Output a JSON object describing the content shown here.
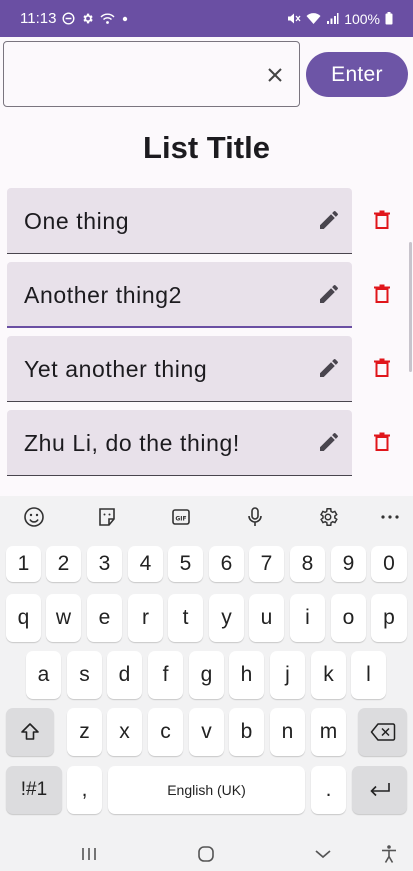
{
  "status_bar": {
    "time": "11:13",
    "battery": "100%",
    "left_icons": [
      "do-not-disturb-icon",
      "gear-icon",
      "wifi-calling-icon",
      "dot-icon"
    ],
    "right_icons": [
      "mute-icon",
      "wifi-icon",
      "signal-icon",
      "battery-icon"
    ]
  },
  "input": {
    "value": "",
    "placeholder": "",
    "clear_icon": "close-icon",
    "enter_label": "Enter"
  },
  "list": {
    "title": "List Title",
    "items": [
      {
        "text": "One thing",
        "edit_icon": "pencil-icon",
        "delete_icon": "trash-icon"
      },
      {
        "text": "Another thing2",
        "edit_icon": "pencil-icon",
        "delete_icon": "trash-icon",
        "focused": true
      },
      {
        "text": "Yet another thing",
        "edit_icon": "pencil-icon",
        "delete_icon": "trash-icon"
      },
      {
        "text": "Zhu Li, do the thing!",
        "edit_icon": "pencil-icon",
        "delete_icon": "trash-icon"
      }
    ]
  },
  "keyboard": {
    "toolbar": [
      "emoji-icon",
      "sticker-icon",
      "gif-icon",
      "microphone-icon",
      "settings-icon",
      "more-icon"
    ],
    "row_numbers": [
      "1",
      "2",
      "3",
      "4",
      "5",
      "6",
      "7",
      "8",
      "9",
      "0"
    ],
    "row_1": [
      "q",
      "w",
      "e",
      "r",
      "t",
      "y",
      "u",
      "i",
      "o",
      "p"
    ],
    "row_2": [
      "a",
      "s",
      "d",
      "f",
      "g",
      "h",
      "j",
      "k",
      "l"
    ],
    "row_3": [
      "z",
      "x",
      "c",
      "v",
      "b",
      "n",
      "m"
    ],
    "shift_icon": "shift-icon",
    "backspace_icon": "backspace-icon",
    "symbols_label": "!#1",
    "comma_label": ",",
    "space_label": "English (UK)",
    "period_label": ".",
    "enter_icon": "return-icon"
  },
  "nav_bar": {
    "buttons": [
      "recents-icon",
      "home-icon",
      "back-icon",
      "accessibility-icon"
    ]
  },
  "colors": {
    "primary": "#6a4fa3",
    "danger": "#e0161b",
    "item_background": "#e8e1ea"
  }
}
